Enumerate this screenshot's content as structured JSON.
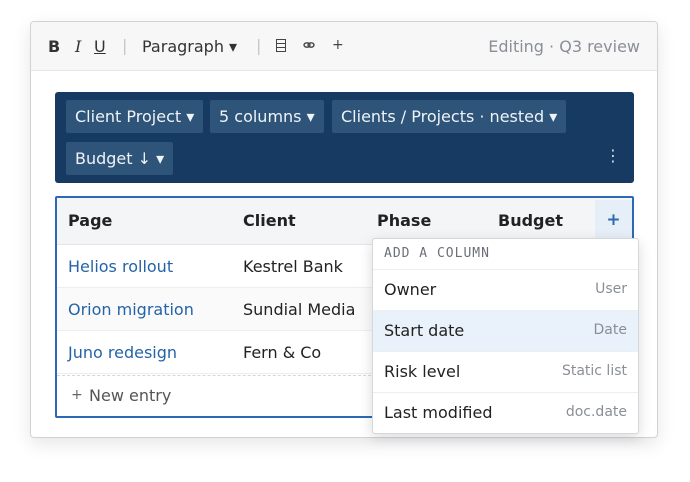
{
  "toolbar": {
    "bold": "B",
    "italic": "I",
    "underline": "U",
    "separator": "|",
    "block_style": "Paragraph ▾",
    "table_icon": "table-icon",
    "link_icon": "link-icon",
    "insert_icon": "plus-icon",
    "status": "Editing · Q3 review"
  },
  "database": {
    "source": "Client Project ▾",
    "columns": "5 columns ▾",
    "grouping": "Clients / Projects · nested ▾",
    "sort": "Budget ↓ ▾",
    "more": "⋮"
  },
  "table": {
    "headers": [
      "Page",
      "Client",
      "Phase",
      "Budget"
    ],
    "add_column": "+",
    "rows": [
      {
        "page": "Helios rollout",
        "client": "Kestrel Bank"
      },
      {
        "page": "Orion migration",
        "client": "Sundial Media"
      },
      {
        "page": "Juno redesign",
        "client": "Fern & Co"
      }
    ],
    "new_entry_icon": "+",
    "new_entry": "New entry"
  },
  "add_column_menu": {
    "heading": "ADD A COLUMN",
    "options": [
      {
        "label": "Owner",
        "type": "User"
      },
      {
        "label": "Start date",
        "type": "Date"
      },
      {
        "label": "Risk level",
        "type": "Static list"
      },
      {
        "label": "Last modified",
        "type": "doc.date"
      }
    ],
    "highlighted_index": 1
  },
  "colors": {
    "accent": "#2c69b3",
    "db_bar": "#173a62",
    "link": "#2563a8"
  }
}
